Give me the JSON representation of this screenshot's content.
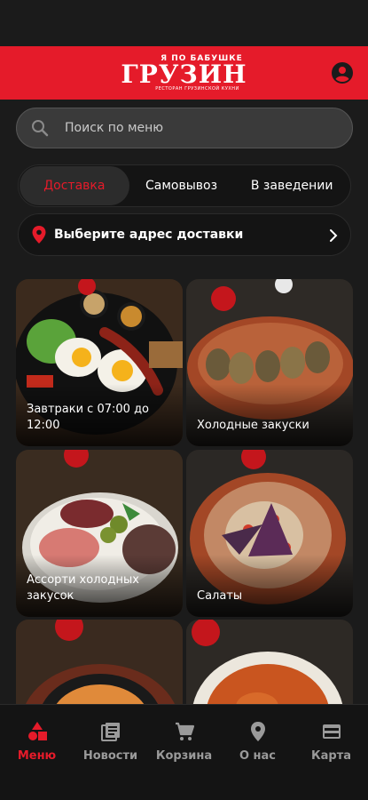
{
  "header": {
    "logo_top": "Я ПО БАБУШКЕ",
    "logo_main": "ГРУЗИН",
    "logo_sub": "РЕСТОРАН ГРУЗИНСКОЙ КУХНИ",
    "brand_color": "#e51b2a"
  },
  "search": {
    "placeholder": "Поиск по меню"
  },
  "tabs": [
    {
      "label": "Доставка",
      "active": true
    },
    {
      "label": "Самовывоз",
      "active": false
    },
    {
      "label": "В заведении",
      "active": false
    }
  ],
  "address": {
    "label": "Выберите адрес доставки"
  },
  "categories": [
    {
      "title": "Завтраки с 07:00 до 12:00"
    },
    {
      "title": "Холодные закуски"
    },
    {
      "title": "Ассорти холодных закусок"
    },
    {
      "title": "Салаты"
    },
    {
      "title": ""
    },
    {
      "title": ""
    }
  ],
  "nav": [
    {
      "label": "Меню",
      "icon": "menu-shapes-icon",
      "active": true
    },
    {
      "label": "Новости",
      "icon": "news-icon",
      "active": false
    },
    {
      "label": "Корзина",
      "icon": "cart-icon",
      "active": false
    },
    {
      "label": "О нас",
      "icon": "location-pin-icon",
      "active": false
    },
    {
      "label": "Карта",
      "icon": "card-icon",
      "active": false
    }
  ]
}
